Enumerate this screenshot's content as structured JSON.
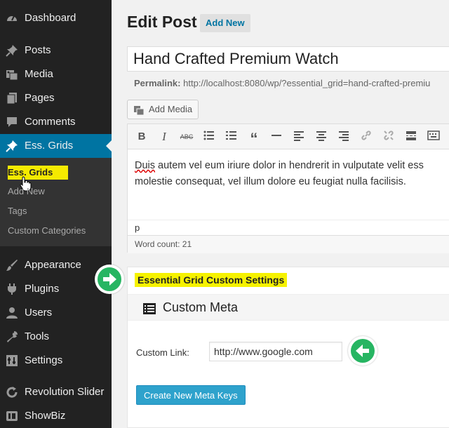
{
  "sidebar": {
    "items": [
      {
        "label": "Dashboard",
        "icon": "dashboard-icon"
      },
      {
        "label": "Posts",
        "icon": "pin-icon"
      },
      {
        "label": "Media",
        "icon": "media-icon"
      },
      {
        "label": "Pages",
        "icon": "pages-icon"
      },
      {
        "label": "Comments",
        "icon": "comments-icon"
      },
      {
        "label": "Ess. Grids",
        "icon": "pin-icon"
      },
      {
        "label": "Appearance",
        "icon": "brush-icon"
      },
      {
        "label": "Plugins",
        "icon": "plugin-icon"
      },
      {
        "label": "Users",
        "icon": "users-icon"
      },
      {
        "label": "Tools",
        "icon": "wrench-icon"
      },
      {
        "label": "Settings",
        "icon": "settings-icon"
      },
      {
        "label": "Revolution Slider",
        "icon": "refresh-icon"
      },
      {
        "label": "ShowBiz",
        "icon": "showbiz-icon"
      }
    ],
    "submenu": [
      "Ess. Grids",
      "Add New",
      "Tags",
      "Custom Categories"
    ]
  },
  "header": {
    "title": "Edit Post",
    "add_new": "Add New"
  },
  "post": {
    "title": "Hand Crafted Premium Watch",
    "permalink_label": "Permalink:",
    "permalink_url": "http://localhost:8080/wp/?essential_grid=hand-crafted-premiu",
    "add_media": "Add Media",
    "content_line1_word": "Duis",
    "content_line1_rest": " autem vel eum iriure dolor in hendrerit in vulputate velit ess",
    "content_line2": "molestie consequat, vel illum dolore eu feugiat nulla facilisis.",
    "path": "p",
    "word_count": "Word count: 21"
  },
  "metabox": {
    "title": "Essential Grid Custom Settings",
    "section": "Custom Meta",
    "custom_link_label": "Custom Link:",
    "custom_link_value": "http://www.google.com",
    "create_button": "Create New Meta Keys"
  },
  "colors": {
    "sidebar_bg": "#222222",
    "active": "#0074a2",
    "highlight": "#f6f200",
    "arrow_green": "#27b562",
    "button_blue": "#2ea2cc"
  }
}
